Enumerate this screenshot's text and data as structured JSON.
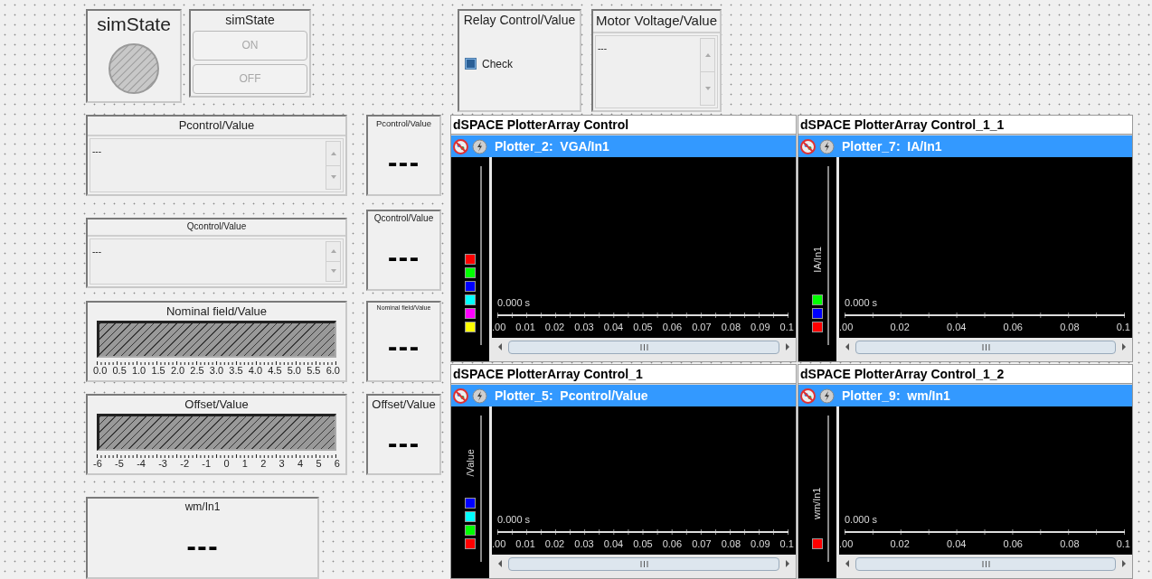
{
  "instruments": [
    {
      "kind": "lamp",
      "title": "simState"
    },
    {
      "kind": "push_buttons",
      "title": "simState",
      "buttons": [
        {
          "label": "ON",
          "disabled": true
        },
        {
          "label": "OFF",
          "disabled": true
        }
      ]
    },
    {
      "kind": "checkbox",
      "title": "Relay Control/Value",
      "label": "Check",
      "checked": false
    },
    {
      "kind": "multiline",
      "title": "Motor Voltage/Value",
      "value": "---"
    },
    {
      "kind": "multiline",
      "title": "Pcontrol/Value",
      "value": "---"
    },
    {
      "kind": "numeric",
      "title": "Pcontrol/Value",
      "value": "---"
    },
    {
      "kind": "multiline",
      "title": "Qcontrol/Value",
      "value": "---"
    },
    {
      "kind": "numeric",
      "title": "Qcontrol/Value",
      "value": "---"
    },
    {
      "kind": "bar_gauge",
      "title": "Nominal field/Value",
      "scale": [
        "0.0",
        "0.5",
        "1.0",
        "1.5",
        "2.0",
        "2.5",
        "3.0",
        "3.5",
        "4.0",
        "4.5",
        "5.0",
        "5.5",
        "6.0"
      ]
    },
    {
      "kind": "numeric",
      "title": "Nominal field/Value",
      "value": "---"
    },
    {
      "kind": "bar_gauge",
      "title": "Offset/Value",
      "scale": [
        "-6",
        "-5",
        "-4",
        "-3",
        "-2",
        "-1",
        "0",
        "1",
        "2",
        "3",
        "4",
        "5",
        "6"
      ]
    },
    {
      "kind": "numeric",
      "title": "Offset/Value",
      "value": "---"
    },
    {
      "kind": "numeric",
      "title": "wm/In1",
      "value": "---"
    }
  ],
  "plotter_arrays": [
    {
      "title": "dSPACE PlotterArray Control",
      "plotter": "Plotter_2:  VGA/In1",
      "legend": [
        {
          "color": "#ff0000"
        },
        {
          "color": "#00ff00"
        },
        {
          "color": "#0000ff"
        },
        {
          "color": "#00ffff"
        },
        {
          "color": "#ff00ff"
        },
        {
          "color": "#ffff00"
        }
      ],
      "time": "0.000 s",
      "x_tick_labels": [
        ".00",
        "0.01",
        "0.02",
        "0.03",
        "0.04",
        "0.05",
        "0.06",
        "0.07",
        "0.08",
        "0.09",
        "0.1"
      ]
    },
    {
      "title": "dSPACE PlotterArray Control_1_1",
      "plotter": "Plotter_7:  IA/In1",
      "signal_label": "IA/In1",
      "legend": [
        {
          "color": "#00ff00"
        },
        {
          "color": "#0000ff"
        },
        {
          "color": "#ff0000"
        }
      ],
      "time": "0.000 s",
      "x_tick_labels": [
        ".00",
        "0.02",
        "0.04",
        "0.06",
        "0.08",
        "0.1"
      ]
    },
    {
      "title": "dSPACE PlotterArray Control_1",
      "plotter": "Plotter_5:  Pcontrol/Value",
      "signal_label": "/Value",
      "legend": [
        {
          "color": "#0000ff"
        },
        {
          "color": "#00ffff"
        },
        {
          "color": "#00ff00"
        },
        {
          "color": "#ff0000"
        }
      ],
      "time": "0.000 s",
      "x_tick_labels": [
        ".00",
        "0.01",
        "0.02",
        "0.03",
        "0.04",
        "0.05",
        "0.06",
        "0.07",
        "0.08",
        "0.09",
        "0.1"
      ]
    },
    {
      "title": "dSPACE PlotterArray Control_1_2",
      "plotter": "Plotter_9:  wm/In1",
      "signal_label": "wm/In1",
      "legend": [
        {
          "color": "#ff0000"
        }
      ],
      "time": "0.000 s",
      "x_tick_labels": [
        ".00",
        "0.02",
        "0.04",
        "0.06",
        "0.08",
        "0.1"
      ]
    }
  ]
}
